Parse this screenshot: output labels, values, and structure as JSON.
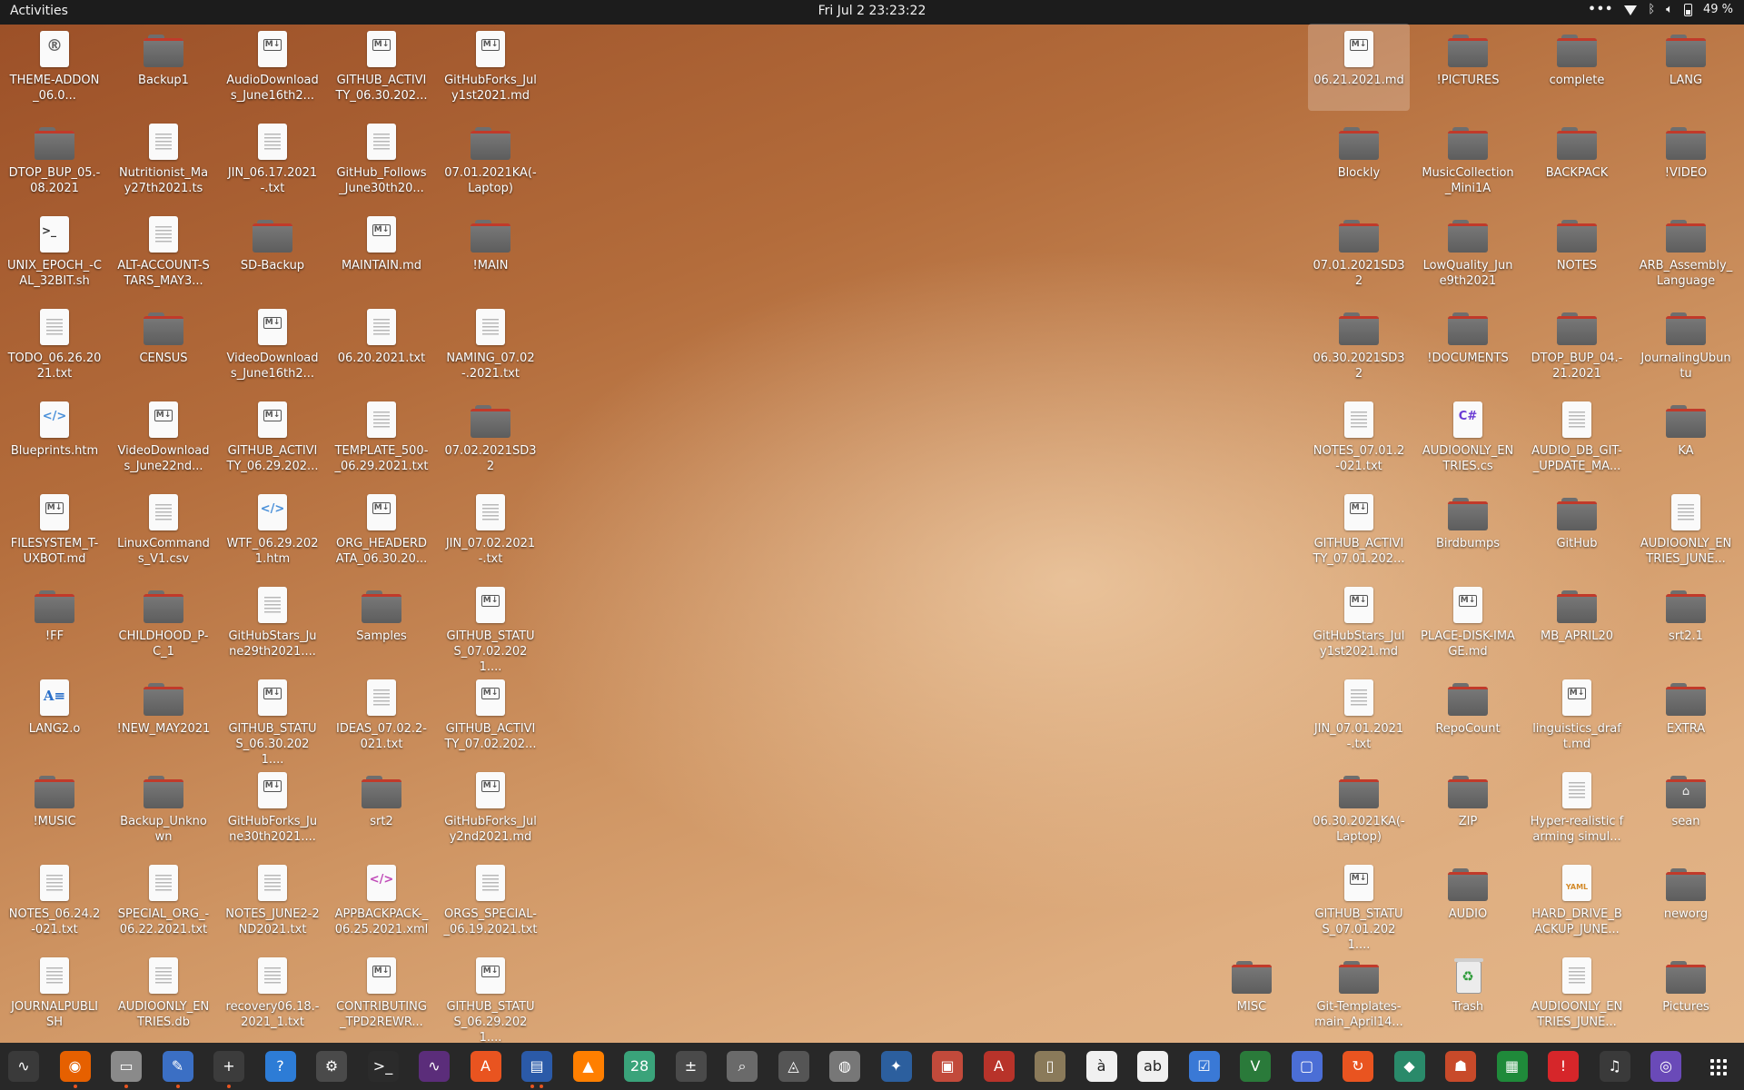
{
  "topbar": {
    "activities": "Activities",
    "clock": "Fri Jul 2  23:23:22",
    "battery": "49 %"
  },
  "desktop_left": [
    {
      "label": "THEME-ADDON_06.0...",
      "type": "doc",
      "mark": "rg"
    },
    {
      "label": "Backup1",
      "type": "folder"
    },
    {
      "label": "AudioDownloads_June16th2...",
      "type": "doc",
      "mark": "md"
    },
    {
      "label": "GITHUB_ACTIVITY_06.30.202...",
      "type": "doc",
      "mark": "md"
    },
    {
      "label": "GitHubForks_July1st2021.md",
      "type": "doc",
      "mark": "md"
    },
    {
      "label": "DTOP_BUP_05.-08.2021",
      "type": "folder"
    },
    {
      "label": "Nutritionist_May27th2021.ts",
      "type": "doc",
      "mark": "lines"
    },
    {
      "label": "JIN_06.17.2021-.txt",
      "type": "doc",
      "mark": "lines"
    },
    {
      "label": "GitHub_Follows_June30th20...",
      "type": "doc",
      "mark": "lines"
    },
    {
      "label": "07.01.2021KA(-Laptop)",
      "type": "folder"
    },
    {
      "label": "UNIX_EPOCH_-CAL_32BIT.sh",
      "type": "doc",
      "mark": "sh"
    },
    {
      "label": "ALT-ACCOUNT-STARS_MAY3...",
      "type": "doc",
      "mark": "lines"
    },
    {
      "label": "SD-Backup",
      "type": "folder"
    },
    {
      "label": "MAINTAIN.md",
      "type": "doc",
      "mark": "md"
    },
    {
      "label": "!MAIN",
      "type": "folder"
    },
    {
      "label": "TODO_06.26.2021.txt",
      "type": "doc",
      "mark": "lines"
    },
    {
      "label": "CENSUS",
      "type": "folder"
    },
    {
      "label": "VideoDownloads_June16th2...",
      "type": "doc",
      "mark": "md"
    },
    {
      "label": "06.20.2021.txt",
      "type": "doc",
      "mark": "lines"
    },
    {
      "label": "NAMING_07.02-.2021.txt",
      "type": "doc",
      "mark": "lines"
    },
    {
      "label": "Blueprints.htm",
      "type": "doc",
      "mark": "code"
    },
    {
      "label": "VideoDownloads_June22nd...",
      "type": "doc",
      "mark": "md"
    },
    {
      "label": "GITHUB_ACTIVITY_06.29.202...",
      "type": "doc",
      "mark": "md"
    },
    {
      "label": "TEMPLATE_500-_06.29.2021.txt",
      "type": "doc",
      "mark": "lines"
    },
    {
      "label": "07.02.2021SD32",
      "type": "folder"
    },
    {
      "label": "FILESYSTEM_T-UXBOT.md",
      "type": "doc",
      "mark": "md"
    },
    {
      "label": "LinuxCommands_V1.csv",
      "type": "doc",
      "mark": "lines"
    },
    {
      "label": "WTF_06.29.2021.htm",
      "type": "doc",
      "mark": "code"
    },
    {
      "label": "ORG_HEADERDATA_06.30.20...",
      "type": "doc",
      "mark": "md"
    },
    {
      "label": "JIN_07.02.2021-.txt",
      "type": "doc",
      "mark": "lines"
    },
    {
      "label": "!FF",
      "type": "folder"
    },
    {
      "label": "CHILDHOOD_P-C_1",
      "type": "folder"
    },
    {
      "label": "GitHubStars_June29th2021....",
      "type": "doc",
      "mark": "lines"
    },
    {
      "label": "Samples",
      "type": "folder"
    },
    {
      "label": "GITHUB_STATUS_07.02.2021....",
      "type": "doc",
      "mark": "md"
    },
    {
      "label": "LANG2.o",
      "type": "doc",
      "mark": "a"
    },
    {
      "label": "!NEW_MAY2021",
      "type": "folder"
    },
    {
      "label": "GITHUB_STATUS_06.30.2021....",
      "type": "doc",
      "mark": "md"
    },
    {
      "label": "IDEAS_07.02.2-021.txt",
      "type": "doc",
      "mark": "lines"
    },
    {
      "label": "GITHUB_ACTIVITY_07.02.202...",
      "type": "doc",
      "mark": "md"
    },
    {
      "label": "!MUSIC",
      "type": "folder"
    },
    {
      "label": "Backup_Unknown",
      "type": "folder"
    },
    {
      "label": "GitHubForks_June30th2021....",
      "type": "doc",
      "mark": "md"
    },
    {
      "label": "srt2",
      "type": "folder"
    },
    {
      "label": "GitHubForks_July2nd2021.md",
      "type": "doc",
      "mark": "md"
    },
    {
      "label": "NOTES_06.24.2-021.txt",
      "type": "doc",
      "mark": "lines"
    },
    {
      "label": "SPECIAL_ORG_-06.22.2021.txt",
      "type": "doc",
      "mark": "lines"
    },
    {
      "label": "NOTES_JUNE2-2ND2021.txt",
      "type": "doc",
      "mark": "lines"
    },
    {
      "label": "APPBACKPACK-_06.25.2021.xml",
      "type": "doc",
      "mark": "xml"
    },
    {
      "label": "ORGS_SPECIAL-_06.19.2021.txt",
      "type": "doc",
      "mark": "lines"
    },
    {
      "label": "JOURNALPUBLISH",
      "type": "doc",
      "mark": "lines"
    },
    {
      "label": "AUDIOONLY_ENTRIES.db",
      "type": "doc",
      "mark": "lines"
    },
    {
      "label": "recovery06.18.-2021_1.txt",
      "type": "doc",
      "mark": "lines"
    },
    {
      "label": "CONTRIBUTING_TPD2REWR...",
      "type": "doc",
      "mark": "md"
    },
    {
      "label": "GITHUB_STATUS_06.29.2021....",
      "type": "doc",
      "mark": "md"
    }
  ],
  "desktop_right": [
    {
      "label": "06.21.2021.md",
      "type": "doc",
      "mark": "md",
      "selected": true
    },
    {
      "label": "!PICTURES",
      "type": "folder"
    },
    {
      "label": "complete",
      "type": "folder"
    },
    {
      "label": "LANG",
      "type": "folder"
    },
    {
      "label": "Blockly",
      "type": "folder"
    },
    {
      "label": "MusicCollection_Mini1A",
      "type": "folder"
    },
    {
      "label": "BACKPACK",
      "type": "folder"
    },
    {
      "label": "!VIDEO",
      "type": "folder"
    },
    {
      "label": "07.01.2021SD32",
      "type": "folder"
    },
    {
      "label": "LowQuality_June9th2021",
      "type": "folder"
    },
    {
      "label": "NOTES",
      "type": "folder"
    },
    {
      "label": "ARB_Assembly_Language",
      "type": "folder"
    },
    {
      "label": "06.30.2021SD32",
      "type": "folder"
    },
    {
      "label": "!DOCUMENTS",
      "type": "folder"
    },
    {
      "label": "DTOP_BUP_04.-21.2021",
      "type": "folder"
    },
    {
      "label": "JournalingUbuntu",
      "type": "folder"
    },
    {
      "label": "NOTES_07.01.2-021.txt",
      "type": "doc",
      "mark": "lines"
    },
    {
      "label": "AUDIOONLY_ENTRIES.cs",
      "type": "doc",
      "mark": "cs"
    },
    {
      "label": "AUDIO_DB_GIT-_UPDATE_MA...",
      "type": "doc",
      "mark": "lines"
    },
    {
      "label": "KA",
      "type": "folder"
    },
    {
      "label": "GITHUB_ACTIVITY_07.01.202...",
      "type": "doc",
      "mark": "md"
    },
    {
      "label": "Birdbumps",
      "type": "folder"
    },
    {
      "label": "GitHub",
      "type": "folder"
    },
    {
      "label": "AUDIOONLY_ENTRIES_JUNE...",
      "type": "doc",
      "mark": "lines"
    },
    {
      "label": "GitHubStars_July1st2021.md",
      "type": "doc",
      "mark": "md"
    },
    {
      "label": "PLACE-DISK-IMAGE.md",
      "type": "doc",
      "mark": "md"
    },
    {
      "label": "MB_APRIL20",
      "type": "folder"
    },
    {
      "label": "srt2.1",
      "type": "folder"
    },
    {
      "label": "JIN_07.01.2021-.txt",
      "type": "doc",
      "mark": "lines"
    },
    {
      "label": "RepoCount",
      "type": "folder"
    },
    {
      "label": "linguistics_draft.md",
      "type": "doc",
      "mark": "md"
    },
    {
      "label": "EXTRA",
      "type": "folder"
    },
    {
      "label": "06.30.2021KA(-Laptop)",
      "type": "folder"
    },
    {
      "label": "ZIP",
      "type": "folder"
    },
    {
      "label": "Hyper-realistic farming simul...",
      "type": "doc",
      "mark": "lines"
    },
    {
      "label": "sean",
      "type": "folder",
      "mark": "home"
    },
    {
      "label": "GITHUB_STATUS_07.01.2021....",
      "type": "doc",
      "mark": "md"
    },
    {
      "label": "AUDIO",
      "type": "folder"
    },
    {
      "label": "HARD_DRIVE_BACKUP_JUNE...",
      "type": "doc",
      "mark": "yaml"
    },
    {
      "label": "neworg",
      "type": "folder"
    },
    {
      "label": "MISC",
      "type": "folder"
    },
    {
      "label": "Git-Templates-main_April14...",
      "type": "folder"
    },
    {
      "label": "Trash",
      "type": "trash"
    },
    {
      "label": "AUDIOONLY_ENTRIES_JUNE...",
      "type": "doc",
      "mark": "lines"
    },
    {
      "label": "Pictures",
      "type": "folder"
    }
  ],
  "dock": [
    {
      "name": "system-monitor-icon",
      "glyph": "∿",
      "color": "#3a3a3a"
    },
    {
      "name": "firefox-icon",
      "glyph": "◉",
      "color": "#e66000",
      "pip": 1
    },
    {
      "name": "files-icon",
      "glyph": "▭",
      "color": "#8a8a8a",
      "pip": 1
    },
    {
      "name": "text-editor-icon",
      "glyph": "✎",
      "color": "#3b6fc4",
      "pip": 1
    },
    {
      "name": "add-icon",
      "glyph": "+",
      "color": "#3c3c3c",
      "pip": 1
    },
    {
      "name": "help-icon",
      "glyph": "?",
      "color": "#2d7cd6"
    },
    {
      "name": "settings-icon",
      "glyph": "⚙",
      "color": "#4a4a4a"
    },
    {
      "name": "terminal-icon",
      "glyph": ">_",
      "color": "#2b2b2b"
    },
    {
      "name": "graph-icon",
      "glyph": "∿",
      "color": "#5b2d7a"
    },
    {
      "name": "software-icon",
      "glyph": "A",
      "color": "#e95420"
    },
    {
      "name": "document-viewer-icon",
      "glyph": "▤",
      "color": "#2b5aa8",
      "pip": 2
    },
    {
      "name": "vlc-icon",
      "glyph": "▲",
      "color": "#ff7f00"
    },
    {
      "name": "calendar-icon",
      "glyph": "28",
      "color": "#3aa37a"
    },
    {
      "name": "calculator-icon",
      "glyph": "±",
      "color": "#4a4a4a"
    },
    {
      "name": "image-viewer-icon",
      "glyph": "⌕",
      "color": "#6a6a6a"
    },
    {
      "name": "git-icon",
      "glyph": "◬",
      "color": "#555"
    },
    {
      "name": "disk-icon",
      "glyph": "◍",
      "color": "#777"
    },
    {
      "name": "lazpaint-icon",
      "glyph": "✦",
      "color": "#2c5f9e"
    },
    {
      "name": "slides-icon",
      "glyph": "▣",
      "color": "#c24a3b"
    },
    {
      "name": "pdf-icon",
      "glyph": "A",
      "color": "#b8332a"
    },
    {
      "name": "archive-icon",
      "glyph": "▯",
      "color": "#8a7a5a"
    },
    {
      "name": "character-map-icon",
      "glyph": "à",
      "color": "#f0f0f0"
    },
    {
      "name": "spelling-icon",
      "glyph": "ab",
      "color": "#f0f0f0"
    },
    {
      "name": "tasks-icon",
      "glyph": "☑",
      "color": "#3a79d6"
    },
    {
      "name": "vim-icon",
      "glyph": "V",
      "color": "#2a7a3a"
    },
    {
      "name": "screen-icon",
      "glyph": "▢",
      "color": "#4b6ed6"
    },
    {
      "name": "update-icon",
      "glyph": "↻",
      "color": "#e95420"
    },
    {
      "name": "education-icon",
      "glyph": "◆",
      "color": "#2a8a6a"
    },
    {
      "name": "game-icon",
      "glyph": "☗",
      "color": "#c84a2a"
    },
    {
      "name": "spreadsheet-icon",
      "glyph": "▦",
      "color": "#1f8a3a"
    },
    {
      "name": "alert-icon",
      "glyph": "!",
      "color": "#d6262a"
    },
    {
      "name": "music-icon",
      "glyph": "♫",
      "color": "#3a3a3a"
    },
    {
      "name": "screenshot-icon",
      "glyph": "◎",
      "color": "#6a4ab8"
    }
  ],
  "dock_apps_label": "Show Applications"
}
